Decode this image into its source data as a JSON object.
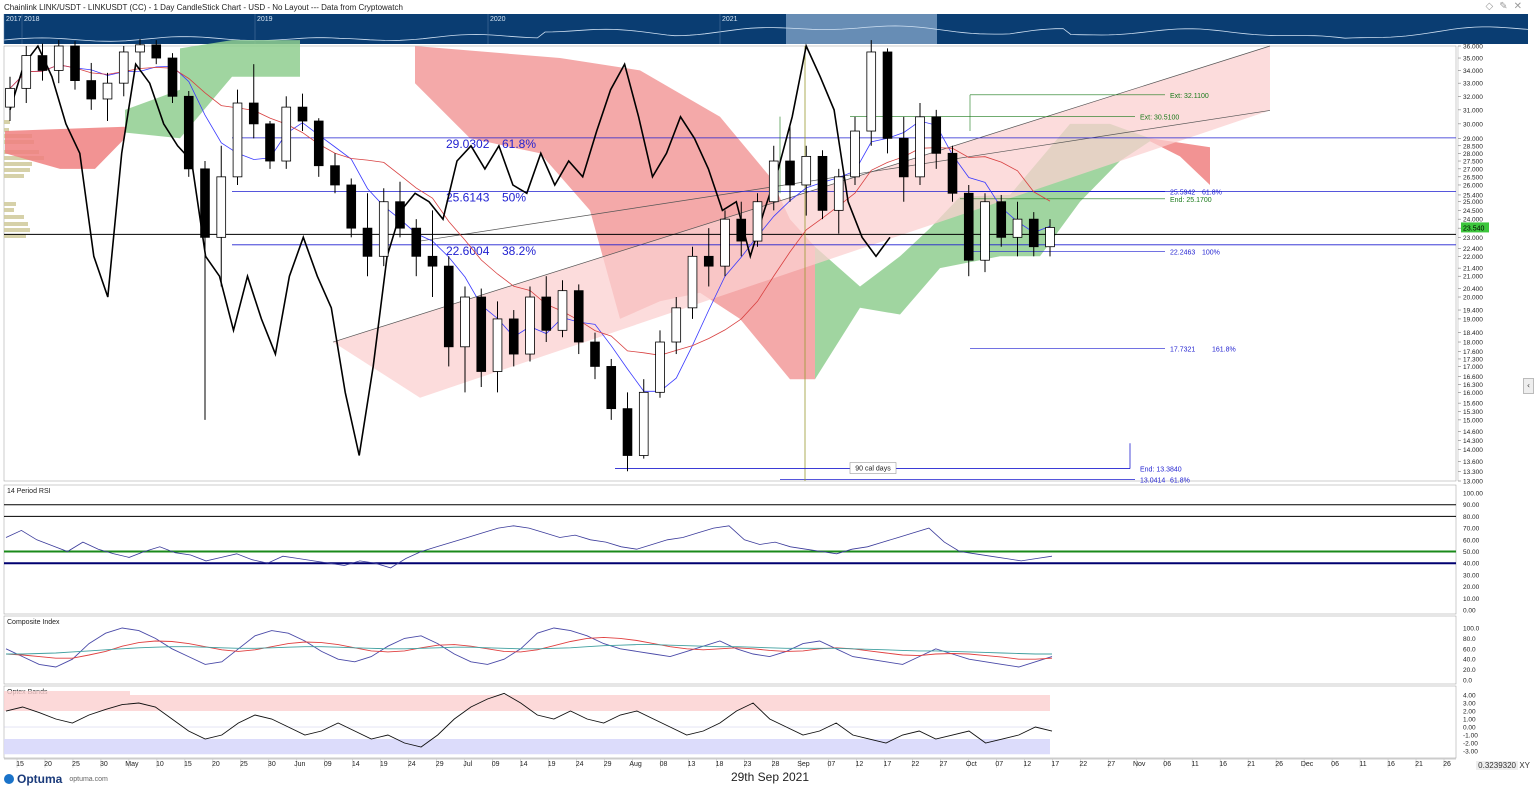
{
  "app": {
    "title": "Chainlink LINK/USDT - LINKUSDT (CC) - 1 Day CandleStick Chart - USD - No Layout --- Data from Cryptowatch",
    "date": "29th Sep 2021",
    "logo": "Optuma",
    "logo_site": "optuma.com",
    "scroll_ratio": "0.3239320",
    "xy_label": "XY",
    "icons": [
      "diamond-icon",
      "pencil-icon",
      "close-icon"
    ]
  },
  "navigator": {
    "years": [
      "2017",
      "2018",
      "2019",
      "2020",
      "2021"
    ]
  },
  "colors": {
    "navigator_bg": "#0a3d72",
    "fib_blue": "#1f1fd0",
    "ext_green": "#1a7a1a",
    "cloud_red": "#f29a9a",
    "cloud_green": "#8fce8f",
    "channel_pink": "#fbd0d0",
    "tenkan": "#3a3aff",
    "kijun": "#d84040",
    "rsi_green": "#1a8a1a",
    "rsi_navy": "#000070",
    "price_box": "#3cc63c"
  },
  "chart_data": [
    {
      "type": "candlestick",
      "title": "Chainlink LINK/USDT - LINKUSDT (CC) - 1 Day CandleStick Chart - USD - No Layout --- Data from Cryptowatch",
      "x_ticks": [
        "15",
        "20",
        "25",
        "30",
        "May",
        "10",
        "15",
        "20",
        "25",
        "30",
        "Jun",
        "09",
        "14",
        "19",
        "24",
        "29",
        "Jul",
        "09",
        "14",
        "19",
        "24",
        "29",
        "Aug",
        "08",
        "13",
        "18",
        "23",
        "28",
        "Sep",
        "07",
        "12",
        "17",
        "22",
        "27",
        "Oct",
        "07",
        "12",
        "17",
        "22",
        "27",
        "Nov",
        "06",
        "11",
        "16",
        "21",
        "26",
        "Dec",
        "06",
        "11",
        "16",
        "21",
        "26"
      ],
      "y_ticks": [
        "36.000",
        "35.000",
        "34.000",
        "33.000",
        "32.000",
        "31.000",
        "30.000",
        "29.000",
        "28.500",
        "28.000",
        "27.500",
        "27.000",
        "26.500",
        "26.000",
        "25.400",
        "25.000",
        "24.500",
        "24.000",
        "23.500",
        "23.000",
        "22.400",
        "22.000",
        "21.400",
        "21.000",
        "20.400",
        "20.000",
        "19.400",
        "19.000",
        "18.400",
        "18.000",
        "17.600",
        "17.300",
        "17.000",
        "16.600",
        "16.300",
        "16.000",
        "15.600",
        "15.300",
        "15.000",
        "14.600",
        "14.300",
        "14.000",
        "13.600",
        "13.300",
        "13.000"
      ],
      "ylim": [
        13.0,
        36.0
      ],
      "y_scale": "log",
      "last_price": "23.540",
      "fib_retracements": [
        {
          "price": "29.0302",
          "level": "61.8%"
        },
        {
          "price": "25.6143",
          "level": "50%"
        },
        {
          "price": "22.6004",
          "level": "38.2%"
        }
      ],
      "extensions": [
        {
          "label": "Ext: 32.1100",
          "price": 32.11
        },
        {
          "label": "Ext: 30.5100",
          "price": 30.51
        },
        {
          "label": "End: 25.1700",
          "price": 25.17
        }
      ],
      "fib_projections": [
        {
          "price": "25.5942",
          "level": "61.8%"
        },
        {
          "price": "22.2463",
          "level": "100%"
        },
        {
          "price": "17.7321",
          "level": "161.8%"
        },
        {
          "price": "13.0414",
          "level": "61.8%"
        }
      ],
      "time_annotation": {
        "label": "90 cal days",
        "end_label": "End: 13.3840",
        "end_price": 13.384
      },
      "horizontal_line": 23.16,
      "candles": [
        {
          "o": 31.2,
          "h": 33.5,
          "l": 30.2,
          "c": 32.6
        },
        {
          "o": 32.6,
          "h": 36.0,
          "l": 31.5,
          "c": 35.2
        },
        {
          "o": 35.2,
          "h": 36.2,
          "l": 33.2,
          "c": 34.0
        },
        {
          "o": 34.0,
          "h": 36.5,
          "l": 33.0,
          "c": 36.0
        },
        {
          "o": 36.0,
          "h": 36.4,
          "l": 32.5,
          "c": 33.2
        },
        {
          "o": 33.2,
          "h": 34.6,
          "l": 31.0,
          "c": 31.8
        },
        {
          "o": 31.8,
          "h": 33.8,
          "l": 30.2,
          "c": 33.0
        },
        {
          "o": 33.0,
          "h": 36.0,
          "l": 32.0,
          "c": 35.5
        },
        {
          "o": 35.5,
          "h": 36.6,
          "l": 34.0,
          "c": 36.1
        },
        {
          "o": 36.1,
          "h": 36.5,
          "l": 34.5,
          "c": 35.0
        },
        {
          "o": 35.0,
          "h": 35.4,
          "l": 31.5,
          "c": 32.0
        },
        {
          "o": 32.0,
          "h": 32.4,
          "l": 26.5,
          "c": 27.0
        },
        {
          "o": 27.0,
          "h": 27.5,
          "l": 15.0,
          "c": 23.0
        },
        {
          "o": 23.0,
          "h": 28.5,
          "l": 20.5,
          "c": 26.5
        },
        {
          "o": 26.5,
          "h": 32.5,
          "l": 26.0,
          "c": 31.5
        },
        {
          "o": 31.5,
          "h": 34.5,
          "l": 29.0,
          "c": 30.0
        },
        {
          "o": 30.0,
          "h": 30.2,
          "l": 27.0,
          "c": 27.5
        },
        {
          "o": 27.5,
          "h": 32.0,
          "l": 27.0,
          "c": 31.2
        },
        {
          "o": 31.2,
          "h": 32.2,
          "l": 29.5,
          "c": 30.2
        },
        {
          "o": 30.2,
          "h": 30.4,
          "l": 26.5,
          "c": 27.2
        },
        {
          "o": 27.2,
          "h": 28.0,
          "l": 25.5,
          "c": 26.0
        },
        {
          "o": 26.0,
          "h": 26.4,
          "l": 23.0,
          "c": 23.5
        },
        {
          "o": 23.5,
          "h": 25.5,
          "l": 21.0,
          "c": 22.0
        },
        {
          "o": 22.0,
          "h": 25.8,
          "l": 21.5,
          "c": 25.0
        },
        {
          "o": 25.0,
          "h": 26.2,
          "l": 23.0,
          "c": 23.5
        },
        {
          "o": 23.5,
          "h": 24.0,
          "l": 21.0,
          "c": 22.0
        },
        {
          "o": 22.0,
          "h": 24.5,
          "l": 20.0,
          "c": 21.5
        },
        {
          "o": 21.5,
          "h": 22.0,
          "l": 17.0,
          "c": 17.8
        },
        {
          "o": 17.8,
          "h": 20.5,
          "l": 16.0,
          "c": 20.0
        },
        {
          "o": 20.0,
          "h": 20.4,
          "l": 16.2,
          "c": 16.8
        },
        {
          "o": 16.8,
          "h": 19.8,
          "l": 16.0,
          "c": 19.0
        },
        {
          "o": 19.0,
          "h": 19.4,
          "l": 17.0,
          "c": 17.5
        },
        {
          "o": 17.5,
          "h": 20.5,
          "l": 17.2,
          "c": 20.0
        },
        {
          "o": 20.0,
          "h": 21.0,
          "l": 18.0,
          "c": 18.5
        },
        {
          "o": 18.5,
          "h": 20.8,
          "l": 18.2,
          "c": 20.3
        },
        {
          "o": 20.3,
          "h": 20.6,
          "l": 17.5,
          "c": 18.0
        },
        {
          "o": 18.0,
          "h": 18.4,
          "l": 16.5,
          "c": 17.0
        },
        {
          "o": 17.0,
          "h": 17.3,
          "l": 15.0,
          "c": 15.4
        },
        {
          "o": 15.4,
          "h": 16.0,
          "l": 13.3,
          "c": 13.8
        },
        {
          "o": 13.8,
          "h": 16.5,
          "l": 13.7,
          "c": 16.0
        },
        {
          "o": 16.0,
          "h": 18.5,
          "l": 15.8,
          "c": 18.0
        },
        {
          "o": 18.0,
          "h": 20.0,
          "l": 17.5,
          "c": 19.5
        },
        {
          "o": 19.5,
          "h": 22.5,
          "l": 19.0,
          "c": 22.0
        },
        {
          "o": 22.0,
          "h": 23.5,
          "l": 20.5,
          "c": 21.5
        },
        {
          "o": 21.5,
          "h": 24.5,
          "l": 21.0,
          "c": 24.0
        },
        {
          "o": 24.0,
          "h": 25.0,
          "l": 22.0,
          "c": 22.8
        },
        {
          "o": 22.8,
          "h": 25.5,
          "l": 22.5,
          "c": 25.0
        },
        {
          "o": 25.0,
          "h": 28.5,
          "l": 24.5,
          "c": 27.5
        },
        {
          "o": 27.5,
          "h": 30.0,
          "l": 25.0,
          "c": 26.0
        },
        {
          "o": 26.0,
          "h": 28.5,
          "l": 24.2,
          "c": 27.8
        },
        {
          "o": 27.8,
          "h": 28.2,
          "l": 24.0,
          "c": 24.5
        },
        {
          "o": 24.5,
          "h": 27.0,
          "l": 23.2,
          "c": 26.5
        },
        {
          "o": 26.5,
          "h": 30.5,
          "l": 26.0,
          "c": 29.5
        },
        {
          "o": 29.5,
          "h": 36.5,
          "l": 28.5,
          "c": 35.5
        },
        {
          "o": 35.5,
          "h": 35.8,
          "l": 28.0,
          "c": 29.0
        },
        {
          "o": 29.0,
          "h": 30.5,
          "l": 25.0,
          "c": 26.5
        },
        {
          "o": 26.5,
          "h": 31.5,
          "l": 26.0,
          "c": 30.5
        },
        {
          "o": 30.5,
          "h": 31.0,
          "l": 27.0,
          "c": 28.0
        },
        {
          "o": 28.0,
          "h": 28.5,
          "l": 25.0,
          "c": 25.5
        },
        {
          "o": 25.5,
          "h": 26.0,
          "l": 21.0,
          "c": 21.8
        },
        {
          "o": 21.8,
          "h": 25.5,
          "l": 21.2,
          "c": 25.0
        },
        {
          "o": 25.0,
          "h": 25.4,
          "l": 22.5,
          "c": 23.0
        },
        {
          "o": 23.0,
          "h": 25.0,
          "l": 22.0,
          "c": 24.0
        },
        {
          "o": 24.0,
          "h": 24.4,
          "l": 22.0,
          "c": 22.5
        },
        {
          "o": 22.5,
          "h": 24.0,
          "l": 22.0,
          "c": 23.54
        }
      ],
      "line_close": [
        31.0,
        34.5,
        36.0,
        33.5,
        30.0,
        28.0,
        22.0,
        20.0,
        28.0,
        34.5,
        33.0,
        30.0,
        28.5,
        27.5,
        22.0,
        21.0,
        18.5,
        21.0,
        19.0,
        17.5,
        21.0,
        23.0,
        21.0,
        19.5,
        16.0,
        13.8,
        17.0,
        22.0,
        24.5,
        25.5,
        25.0,
        24.0,
        27.5,
        28.5,
        27.0,
        28.5,
        26.0,
        25.5,
        28.0,
        26.0,
        27.5,
        26.5,
        29.5,
        32.5,
        34.5,
        30.5,
        26.5,
        28.0,
        30.5,
        29.0,
        27.0,
        24.5,
        25.0,
        22.0,
        24.5,
        27.0,
        30.5,
        36.0,
        33.5,
        31.0,
        25.0,
        23.0,
        22.0,
        23.0
      ]
    },
    {
      "type": "line",
      "title": "14 Period RSI",
      "y_ticks": [
        "100.00",
        "90.00",
        "80.00",
        "70.00",
        "60.00",
        "50.00",
        "40.00",
        "30.00",
        "20.00",
        "10.00",
        "0.00"
      ],
      "ylim": [
        0,
        100
      ],
      "levels": [
        90,
        80,
        50,
        40
      ],
      "values": [
        62,
        68,
        60,
        55,
        50,
        58,
        52,
        48,
        45,
        50,
        54,
        49,
        47,
        42,
        45,
        48,
        43,
        40,
        46,
        44,
        42,
        40,
        38,
        42,
        40,
        36,
        44,
        50,
        54,
        58,
        62,
        66,
        70,
        72,
        70,
        66,
        62,
        64,
        60,
        58,
        54,
        52,
        56,
        60,
        62,
        66,
        70,
        72,
        60,
        56,
        58,
        54,
        52,
        50,
        48,
        52,
        54,
        58,
        62,
        66,
        70,
        58,
        50,
        48,
        46,
        44,
        42,
        44,
        46
      ]
    },
    {
      "type": "line",
      "title": "Composite Index",
      "y_ticks": [
        "100.0",
        "80.0",
        "60.0",
        "40.0",
        "20.0",
        "0.0"
      ],
      "series": [
        {
          "values": [
            60,
            45,
            30,
            25,
            40,
            70,
            90,
            100,
            95,
            80,
            60,
            45,
            30,
            35,
            60,
            85,
            95,
            90,
            75,
            55,
            40,
            35,
            45,
            65,
            80,
            85,
            70,
            50,
            35,
            30,
            40,
            60,
            90,
            100,
            95,
            85,
            70,
            60,
            55,
            50,
            45,
            55,
            65,
            75,
            60,
            50,
            45,
            55,
            70,
            75,
            60,
            45,
            40,
            35,
            30,
            45,
            60,
            50,
            40,
            35,
            30,
            25,
            35,
            45
          ]
        },
        {
          "values": [
            50,
            48,
            45,
            42,
            42,
            48,
            55,
            65,
            72,
            75,
            74,
            70,
            64,
            58,
            55,
            58,
            64,
            70,
            73,
            72,
            68,
            62,
            56,
            54,
            56,
            62,
            67,
            68,
            65,
            60,
            55,
            54,
            58,
            66,
            74,
            80,
            82,
            80,
            76,
            70,
            64,
            60,
            58,
            60,
            62,
            60,
            57,
            55,
            56,
            60,
            62,
            60,
            56,
            52,
            48,
            47,
            50,
            51,
            50,
            47,
            44,
            40,
            40,
            42
          ]
        },
        {
          "values": [
            50,
            50,
            51,
            52,
            54,
            56,
            58,
            60,
            62,
            63,
            64,
            64,
            63,
            62,
            61,
            61,
            62,
            63,
            64,
            64,
            63,
            62,
            61,
            60,
            60,
            61,
            62,
            63,
            63,
            62,
            61,
            60,
            60,
            61,
            62,
            64,
            66,
            67,
            68,
            68,
            67,
            66,
            65,
            64,
            64,
            63,
            62,
            61,
            61,
            61,
            61,
            60,
            59,
            58,
            57,
            56,
            56,
            55,
            54,
            53,
            52,
            51,
            50,
            50
          ]
        }
      ]
    },
    {
      "type": "line",
      "title": "Optex Bands",
      "y_ticks": [
        "4.00",
        "3.00",
        "2.00",
        "1.00",
        "0.00",
        "-1.00",
        "-2.00",
        "-3.00"
      ],
      "ylim": [
        -3.5,
        4.5
      ],
      "values": [
        2.0,
        2.5,
        1.8,
        1.0,
        0.5,
        1.5,
        2.2,
        2.8,
        3.0,
        2.5,
        1.0,
        -0.5,
        -1.5,
        -1.0,
        0.5,
        1.5,
        1.0,
        0.0,
        -1.0,
        -0.5,
        0.5,
        -0.5,
        -1.5,
        -1.0,
        -2.0,
        -2.5,
        -1.0,
        1.0,
        2.5,
        3.5,
        4.2,
        3.0,
        1.5,
        1.0,
        2.0,
        1.0,
        0.5,
        1.5,
        2.0,
        1.0,
        0.0,
        -1.0,
        -0.5,
        0.5,
        2.0,
        3.0,
        1.0,
        0.0,
        -1.0,
        -0.5,
        0.5,
        -1.0,
        -1.5,
        -2.0,
        -1.0,
        -0.5,
        -1.5,
        -1.0,
        -0.5,
        -2.0,
        -1.5,
        -1.0,
        0.0,
        -0.5
      ]
    }
  ]
}
